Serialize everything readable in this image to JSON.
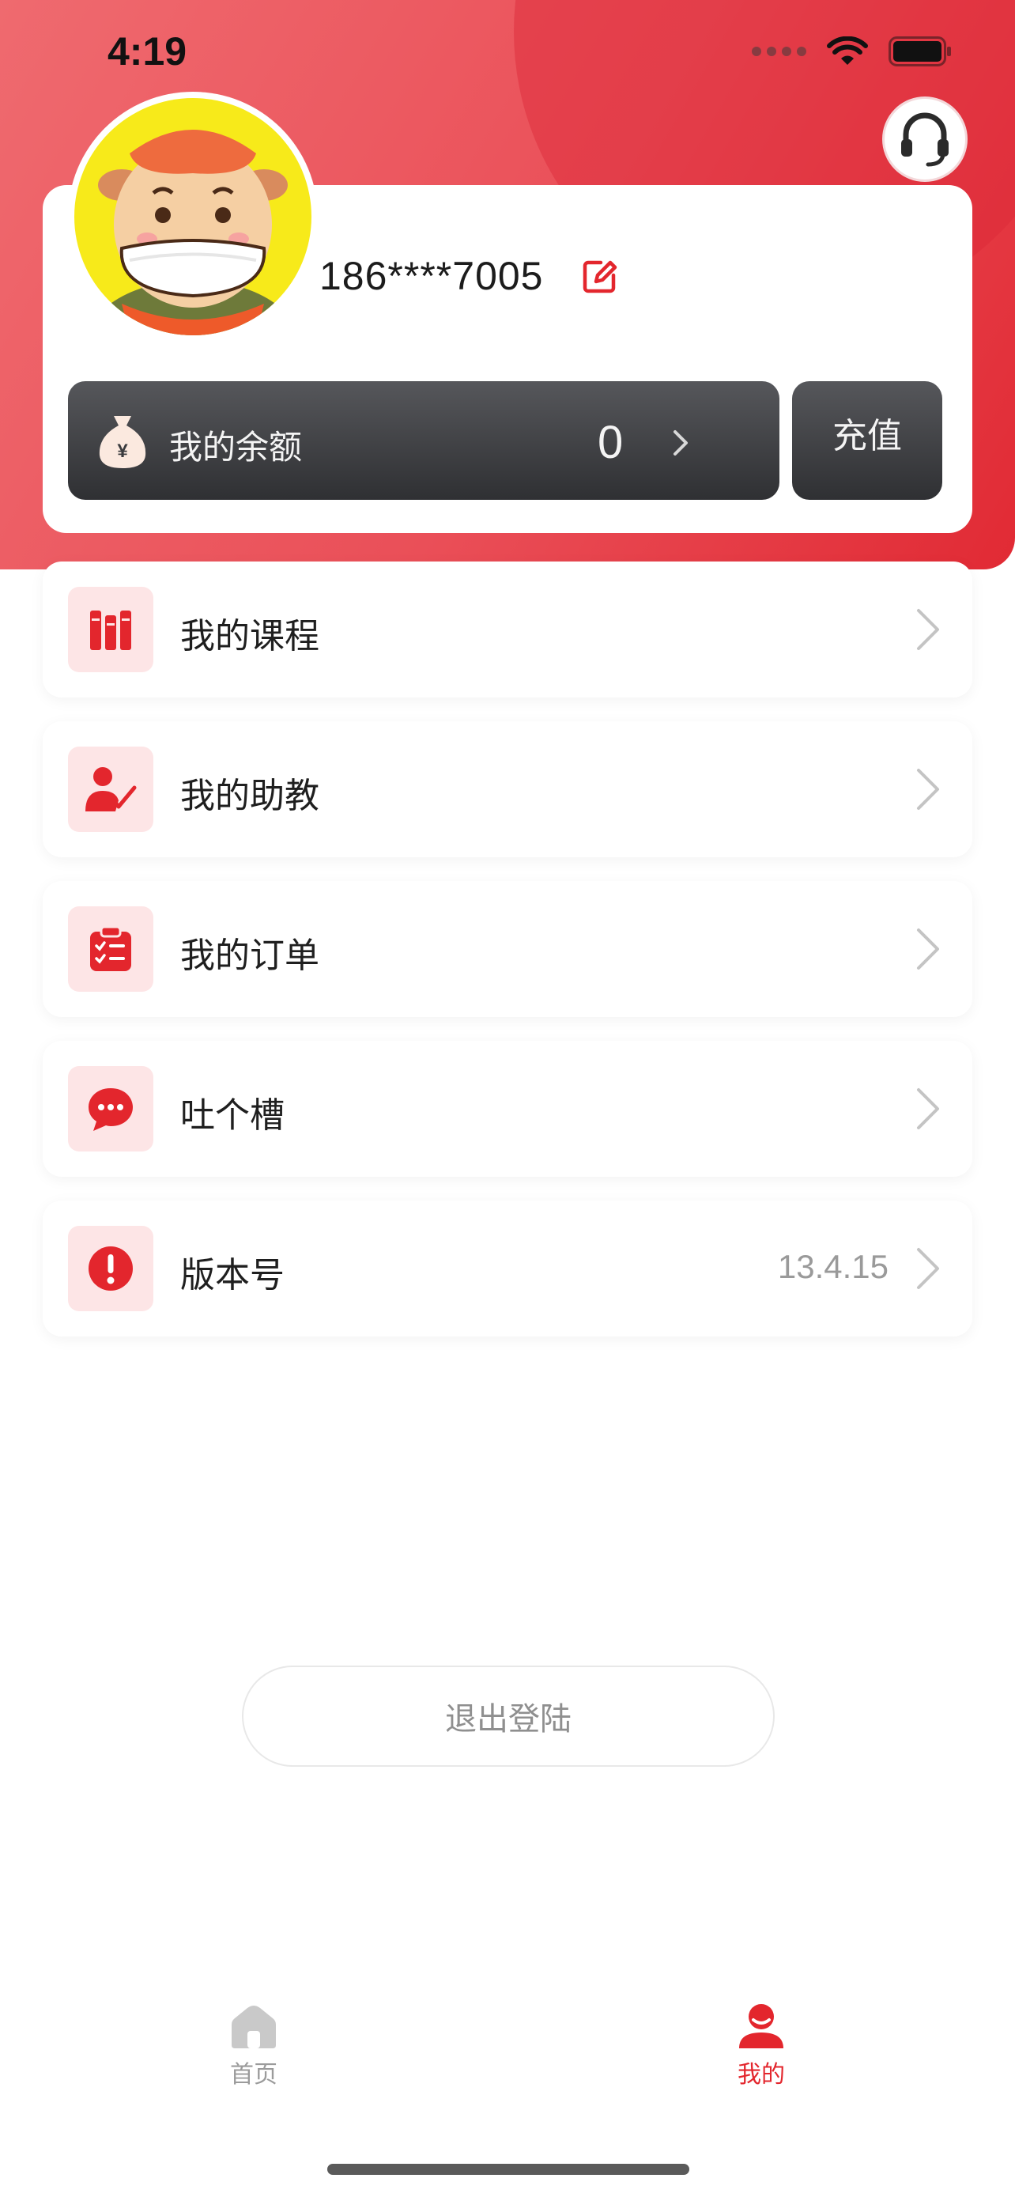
{
  "status_bar": {
    "time": "4:19"
  },
  "profile": {
    "phone": "186****7005",
    "balance_label": "我的余额",
    "balance_value": "0",
    "recharge_label": "充值"
  },
  "menu": {
    "items": [
      {
        "label": "我的课程",
        "icon": "books-icon"
      },
      {
        "label": "我的助教",
        "icon": "teacher-icon"
      },
      {
        "label": "我的订单",
        "icon": "clipboard-icon"
      },
      {
        "label": "吐个槽",
        "icon": "chat-bubble-icon"
      },
      {
        "label": "版本号",
        "icon": "exclamation-icon",
        "value": "13.4.15"
      }
    ]
  },
  "logout_label": "退出登陆",
  "tab_bar": {
    "home_label": "首页",
    "mine_label": "我的",
    "active": "mine"
  },
  "colors": {
    "brand_red": "#e3262d",
    "icon_bg": "#fde5e6",
    "balance_dark": "#3a3b3e"
  }
}
